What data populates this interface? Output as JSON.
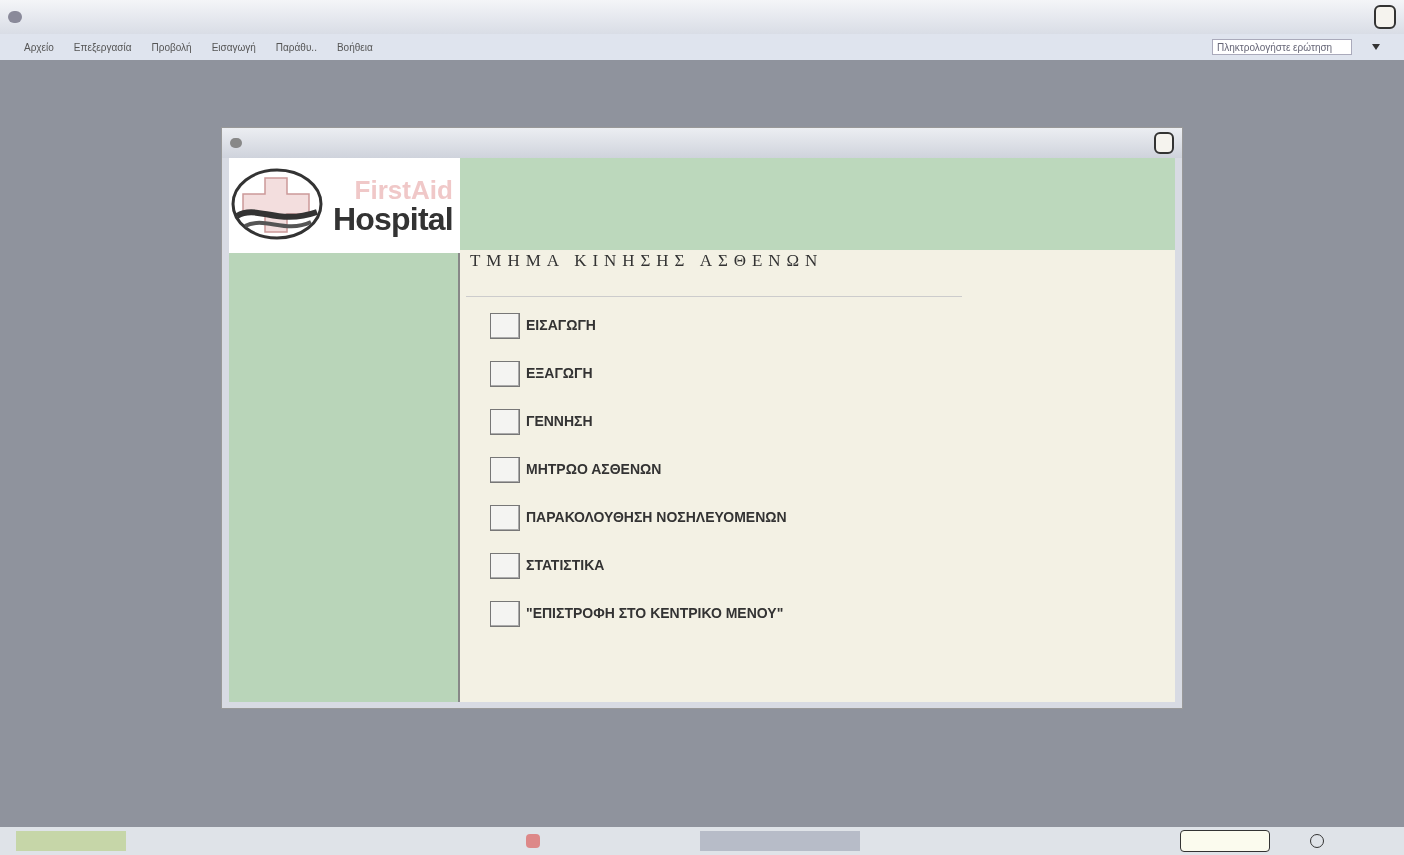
{
  "menu_bar": {
    "items": [
      "Αρχείο",
      "Επεξεργασία",
      "Προβολή",
      "Εισαγωγή",
      "Παράθυ..",
      "Βοήθεια"
    ],
    "help_box": {
      "placeholder": "Πληκτρολογήστε ερώτηση"
    }
  },
  "form": {
    "logo": {
      "line_1": "FirstAid",
      "line_2": "Hospital"
    },
    "heading": "ΤΜΗΜΑ ΚΙΝΗΣΗΣ ΑΣΘΕΝΩΝ",
    "options": [
      {
        "label": "ΕΙΣΑΓΩΓΗ"
      },
      {
        "label": "ΕΞΑΓΩΓΗ"
      },
      {
        "label": "ΓΕΝΝΗΣΗ"
      },
      {
        "label": "ΜΗΤΡΩΟ ΑΣΘΕΝΩΝ"
      },
      {
        "label": "ΠΑΡΑΚΟΛΟΥΘΗΣΗ ΝΟΣΗΛΕΥΟΜΕΝΩΝ"
      },
      {
        "label": "ΣΤΑΤΙΣΤΙΚΑ"
      },
      {
        "label": "\"ΕΠΙΣΤΡΟΦΗ ΣΤΟ ΚΕΝΤΡΙΚΟ ΜΕΝΟΥ\""
      }
    ]
  }
}
